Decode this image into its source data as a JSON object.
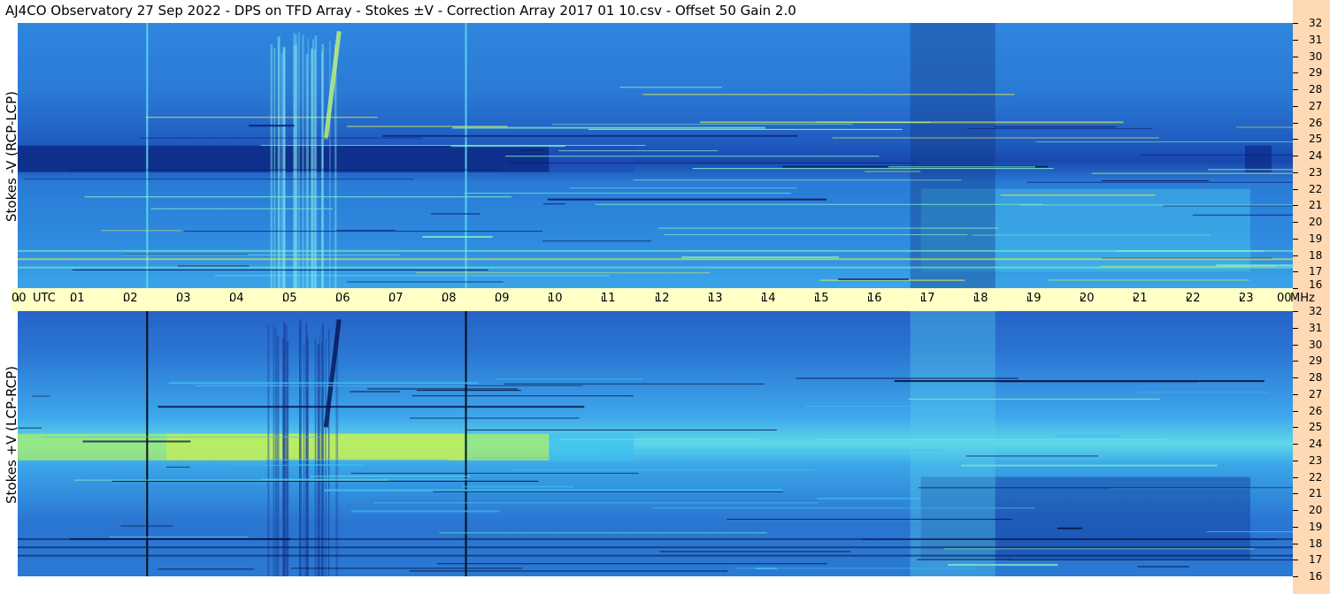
{
  "header": {
    "title": "AJ4CO Observatory  27 Sep 2022  -  DPS on TFD Array  -  Stokes ±V  -  Correction Array 2017 01 10.csv  -  Offset 50  Gain 2.0"
  },
  "panels": [
    {
      "label": "Stokes -V (RCP-LCP)",
      "polarity": "minus"
    },
    {
      "label": "Stokes +V (LCP-RCP)",
      "polarity": "plus"
    }
  ],
  "time_axis": {
    "labels": [
      "00",
      "01",
      "02",
      "03",
      "04",
      "05",
      "06",
      "07",
      "08",
      "09",
      "10",
      "11",
      "12",
      "13",
      "14",
      "15",
      "16",
      "17",
      "18",
      "19",
      "20",
      "21",
      "22",
      "23",
      "00"
    ],
    "utc_label": "UTC",
    "unit_label": "MHz"
  },
  "frequency_axis": {
    "labels": [
      "32",
      "31",
      "30",
      "29",
      "28",
      "27",
      "26",
      "25",
      "24",
      "23",
      "22",
      "21",
      "20",
      "19",
      "18",
      "17",
      "16"
    ]
  },
  "chart_data": {
    "type": "heatmap",
    "title": "AJ4CO Observatory  27 Sep 2022  -  DPS on TFD Array  -  Stokes ±V  -  Correction Array 2017 01 10.csv  -  Offset 50  Gain 2.0",
    "xlabel": "UTC",
    "ylabel": "MHz",
    "x_range": [
      0,
      24
    ],
    "y_range": [
      16,
      32
    ],
    "x_ticks": [
      "00",
      "01",
      "02",
      "03",
      "04",
      "05",
      "06",
      "07",
      "08",
      "09",
      "10",
      "11",
      "12",
      "13",
      "14",
      "15",
      "16",
      "17",
      "18",
      "19",
      "20",
      "21",
      "22",
      "23",
      "00"
    ],
    "y_ticks": [
      32,
      31,
      30,
      29,
      28,
      27,
      26,
      25,
      24,
      23,
      22,
      21,
      20,
      19,
      18,
      17,
      16
    ],
    "colormap": [
      "#0a1a6b",
      "#1f55c8",
      "#2e86e6",
      "#3ec0f0",
      "#7ef0c8",
      "#e8f04a",
      "#f0a030"
    ],
    "series": [
      {
        "name": "Stokes -V (RCP-LCP)"
      },
      {
        "name": "Stokes +V (LCP-RCP)"
      }
    ]
  }
}
